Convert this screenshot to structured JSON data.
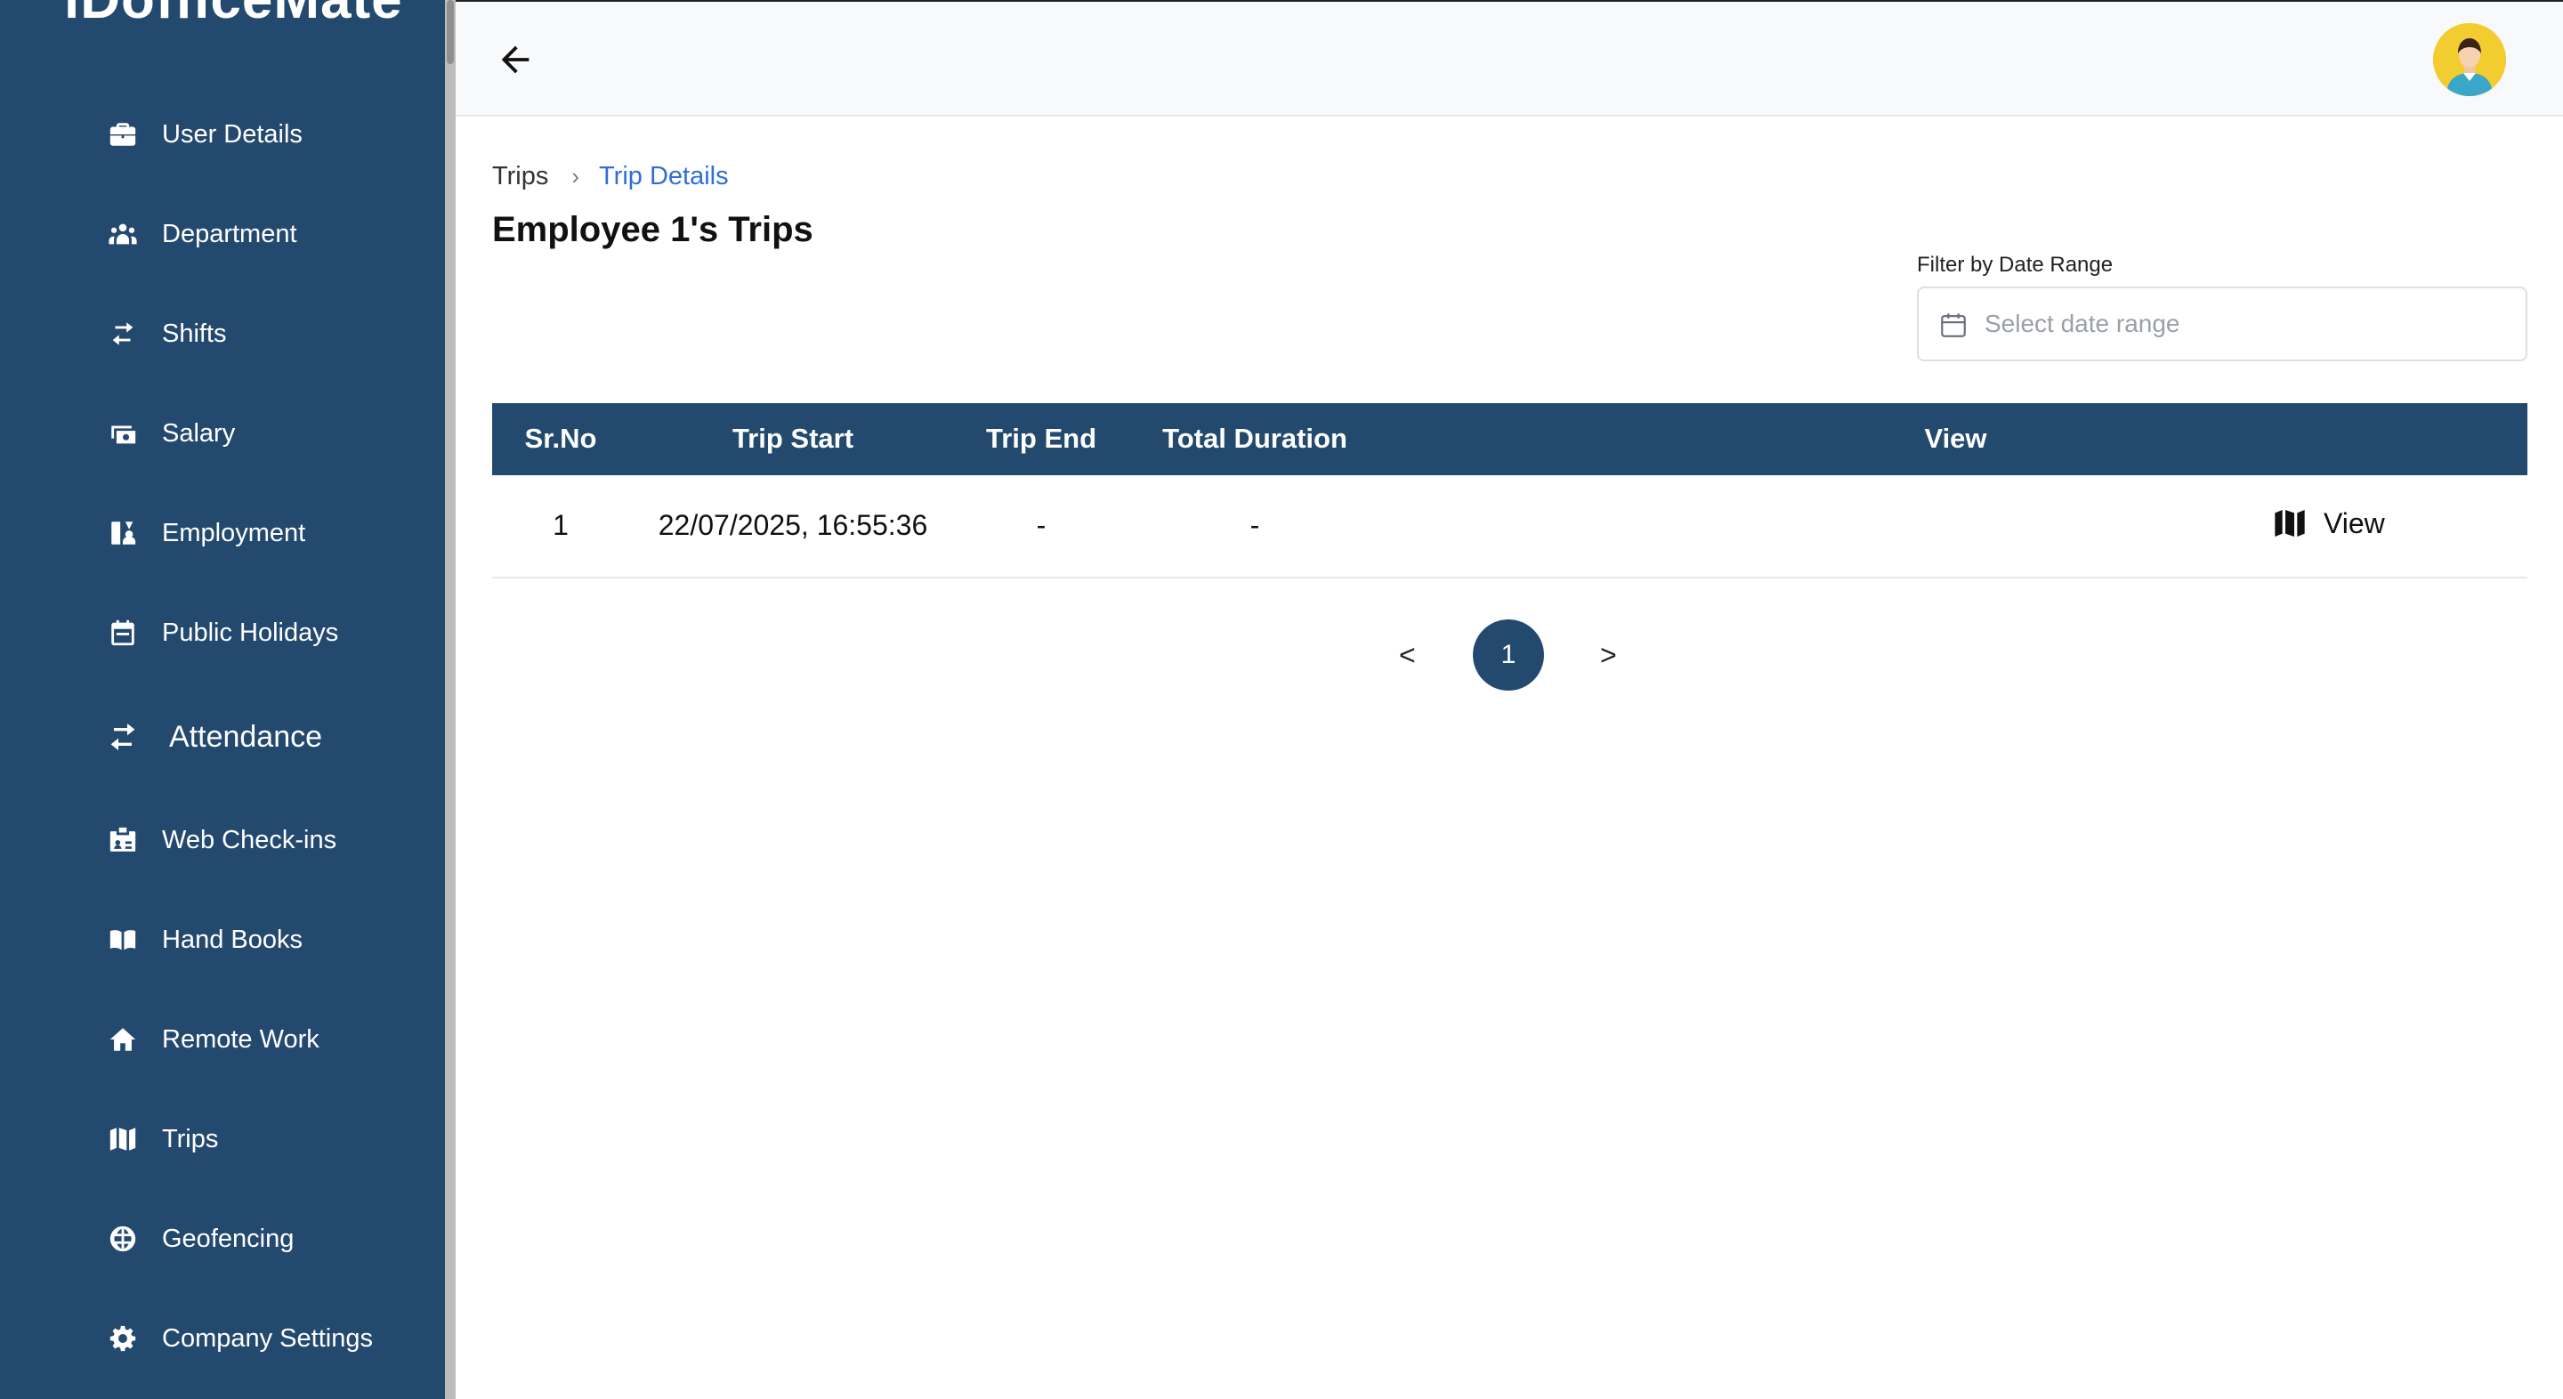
{
  "app": {
    "logo_text": "iDofficeMate"
  },
  "sidebar": {
    "items": [
      {
        "label": "User Details",
        "icon": "briefcase-icon"
      },
      {
        "label": "Department",
        "icon": "people-icon"
      },
      {
        "label": "Shifts",
        "icon": "swap-arrows-icon"
      },
      {
        "label": "Salary",
        "icon": "money-icon"
      },
      {
        "label": "Employment",
        "icon": "employment-icon"
      },
      {
        "label": "Public Holidays",
        "icon": "calendar-icon"
      },
      {
        "label": "Attendance",
        "icon": "swap-arrows-icon"
      },
      {
        "label": "Web Check-ins",
        "icon": "id-card-icon"
      },
      {
        "label": "Hand Books",
        "icon": "book-icon"
      },
      {
        "label": "Remote Work",
        "icon": "home-icon"
      },
      {
        "label": "Trips",
        "icon": "map-icon"
      },
      {
        "label": "Geofencing",
        "icon": "globe-icon"
      },
      {
        "label": "Company Settings",
        "icon": "gear-icon"
      }
    ]
  },
  "header": {
    "back_icon": "arrow-left-icon",
    "avatar_icon": "user-avatar-icon"
  },
  "breadcrumb": {
    "parent": "Trips",
    "separator": "›",
    "current": "Trip Details"
  },
  "page": {
    "title": "Employee 1's Trips"
  },
  "filter": {
    "label": "Filter by Date Range",
    "placeholder": "Select date range",
    "icon": "calendar-outline-icon"
  },
  "table": {
    "headers": [
      "Sr.No",
      "Trip Start",
      "Trip End",
      "Total Duration",
      "View"
    ],
    "rows": [
      {
        "sr_no": "1",
        "trip_start": "22/07/2025, 16:55:36",
        "trip_end": "-",
        "total_duration": "-",
        "view": "View"
      }
    ]
  },
  "pagination": {
    "prev": "<",
    "current": "1",
    "next": ">"
  },
  "colors": {
    "sidebar_bg": "#234a6e",
    "accent": "#2f6fd6",
    "avatar_bg": "#f3cd2f"
  }
}
